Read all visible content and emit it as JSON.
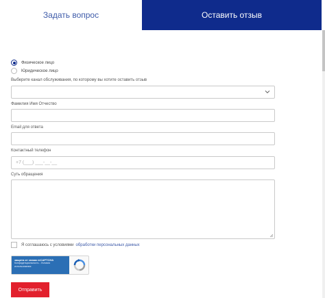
{
  "tabs": {
    "ask_label": "Задать вопрос",
    "review_label": "Оставить отзыв",
    "active_color": "#0f2b8c"
  },
  "person_type": {
    "options": [
      {
        "label": "Физическое лицо",
        "checked": true
      },
      {
        "label": "Юридическое лицо",
        "checked": false
      }
    ]
  },
  "form": {
    "channel_label": "Выберите канал обслуживания, по которому вы хотите оставить отзыв",
    "channel_value": "",
    "fio_label": "Фамилия Имя Отчество",
    "fio_value": "",
    "email_label": "Email для ответа",
    "email_value": "",
    "phone_label": "Контактный телефон",
    "phone_placeholder": "+7 (___) ___-__-__",
    "message_label": "Суть обращения",
    "message_value": ""
  },
  "agreement": {
    "text": "Я соглашаюсь с условиями",
    "link": "обработки персональных данных",
    "checked": false
  },
  "captcha": {
    "title": "защита от спама reCAPTCHA",
    "subtitle": "Конфиденциальность - Условия использования"
  },
  "submit": {
    "label": "Отправить",
    "color": "#e2202d"
  }
}
